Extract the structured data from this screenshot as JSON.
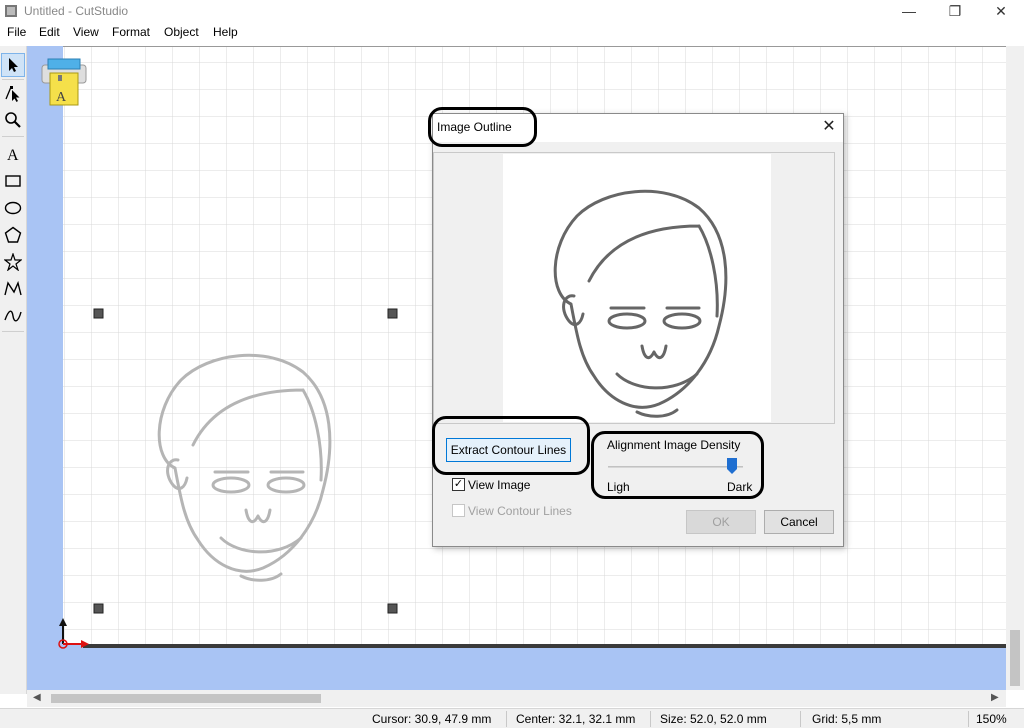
{
  "window": {
    "title": "Untitled - CutStudio",
    "minimize": "—",
    "maximize": "❐",
    "close": "✕"
  },
  "menu": [
    "File",
    "Edit",
    "View",
    "Format",
    "Object",
    "Help"
  ],
  "toolbar": {
    "tools": [
      "select",
      "node-edit",
      "zoom",
      "text",
      "rectangle",
      "ellipse",
      "polygon",
      "star",
      "polyline",
      "bezier-curve"
    ]
  },
  "dialog": {
    "title": "Image Outline",
    "close": "✕",
    "extract_button": "Extract Contour Lines",
    "view_image_label": "View Image",
    "view_image_checked": true,
    "view_contour_label": "View Contour Lines",
    "view_contour_checked": false,
    "density_group_label": "Alignment Image Density",
    "density_min_label": "Ligh",
    "density_max_label": "Dark",
    "density_value": 0.92,
    "ok_button": "OK",
    "cancel_button": "Cancel"
  },
  "status": {
    "cursor": "Cursor: 30.9, 47.9 mm",
    "center": "Center: 32.1, 32.1 mm",
    "size": "Size: 52.0, 52.0 mm",
    "grid": "Grid: 5,5 mm",
    "zoom": "150%"
  },
  "colors": {
    "canvas_margin": "#a9c4f4",
    "grid_line": "#d9d9d9",
    "face_gray": "#b5b5b5",
    "face_dark": "#666666",
    "slider_thumb": "#1f6fd1"
  }
}
